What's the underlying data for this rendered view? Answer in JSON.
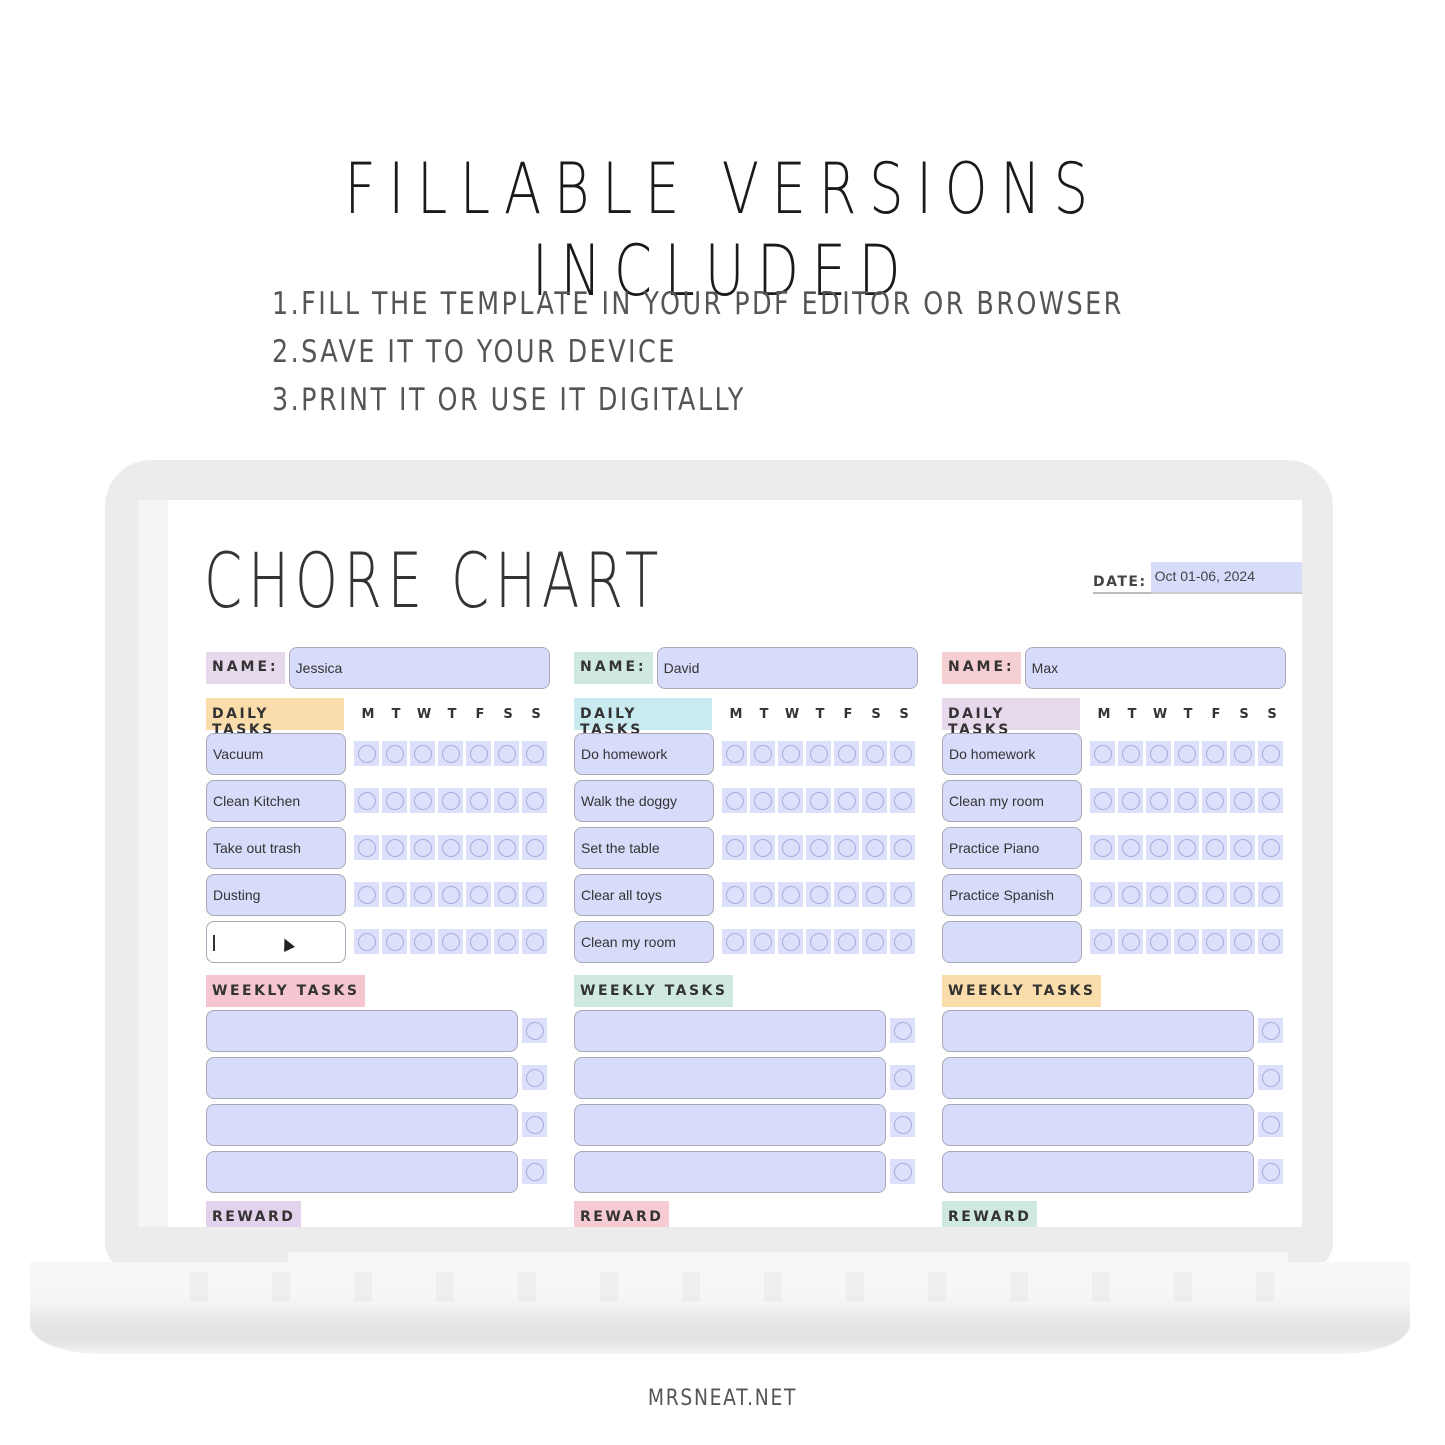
{
  "headline": "FILLABLE VERSIONS INCLUDED",
  "steps": [
    "1.FILL THE TEMPLATE IN YOUR PDF EDITOR OR BROWSER",
    "2.SAVE IT TO YOUR DEVICE",
    "3.PRINT IT OR USE IT DIGITALLY"
  ],
  "chart": {
    "title": "CHORE CHART",
    "date_label": "DATE:",
    "date_value": "Oct 01-06, 2024",
    "name_label": "NAME:",
    "daily_label": "DAILY TASKS",
    "weekly_label": "WEEKLY TASKS",
    "reward_label": "REWARD",
    "days": [
      "M",
      "T",
      "W",
      "T",
      "F",
      "S",
      "S"
    ],
    "kids": [
      {
        "name": "Jessica",
        "colors": {
          "name_tag": "#e6d9ec",
          "daily_tag": "#fbdcab",
          "weekly_tag": "#f5c6cf",
          "reward_tag": "#e2d2ec"
        },
        "daily_tasks": [
          "Vacuum",
          "Clean Kitchen",
          "Take out trash",
          "Dusting",
          ""
        ],
        "active_task_index": 4,
        "weekly_tasks": [
          "",
          "",
          "",
          ""
        ]
      },
      {
        "name": "David",
        "colors": {
          "name_tag": "#cfe9e1",
          "daily_tag": "#c9ebef",
          "weekly_tag": "#cfe9e1",
          "reward_tag": "#f7cbd4"
        },
        "daily_tasks": [
          "Do homework",
          "Walk the doggy",
          "Set the table",
          "Clear all toys",
          "Clean my room"
        ],
        "active_task_index": -1,
        "weekly_tasks": [
          "",
          "",
          "",
          ""
        ]
      },
      {
        "name": "Max",
        "colors": {
          "name_tag": "#f6cfd3",
          "daily_tag": "#e6d9ec",
          "weekly_tag": "#fbdcab",
          "reward_tag": "#cfe9e1"
        },
        "daily_tasks": [
          "Do homework",
          "Clean my room",
          "Practice Piano",
          "Practice Spanish",
          ""
        ],
        "active_task_index": -1,
        "weekly_tasks": [
          "",
          "",
          "",
          ""
        ]
      }
    ]
  },
  "footer": "MRSNEAT.NET"
}
